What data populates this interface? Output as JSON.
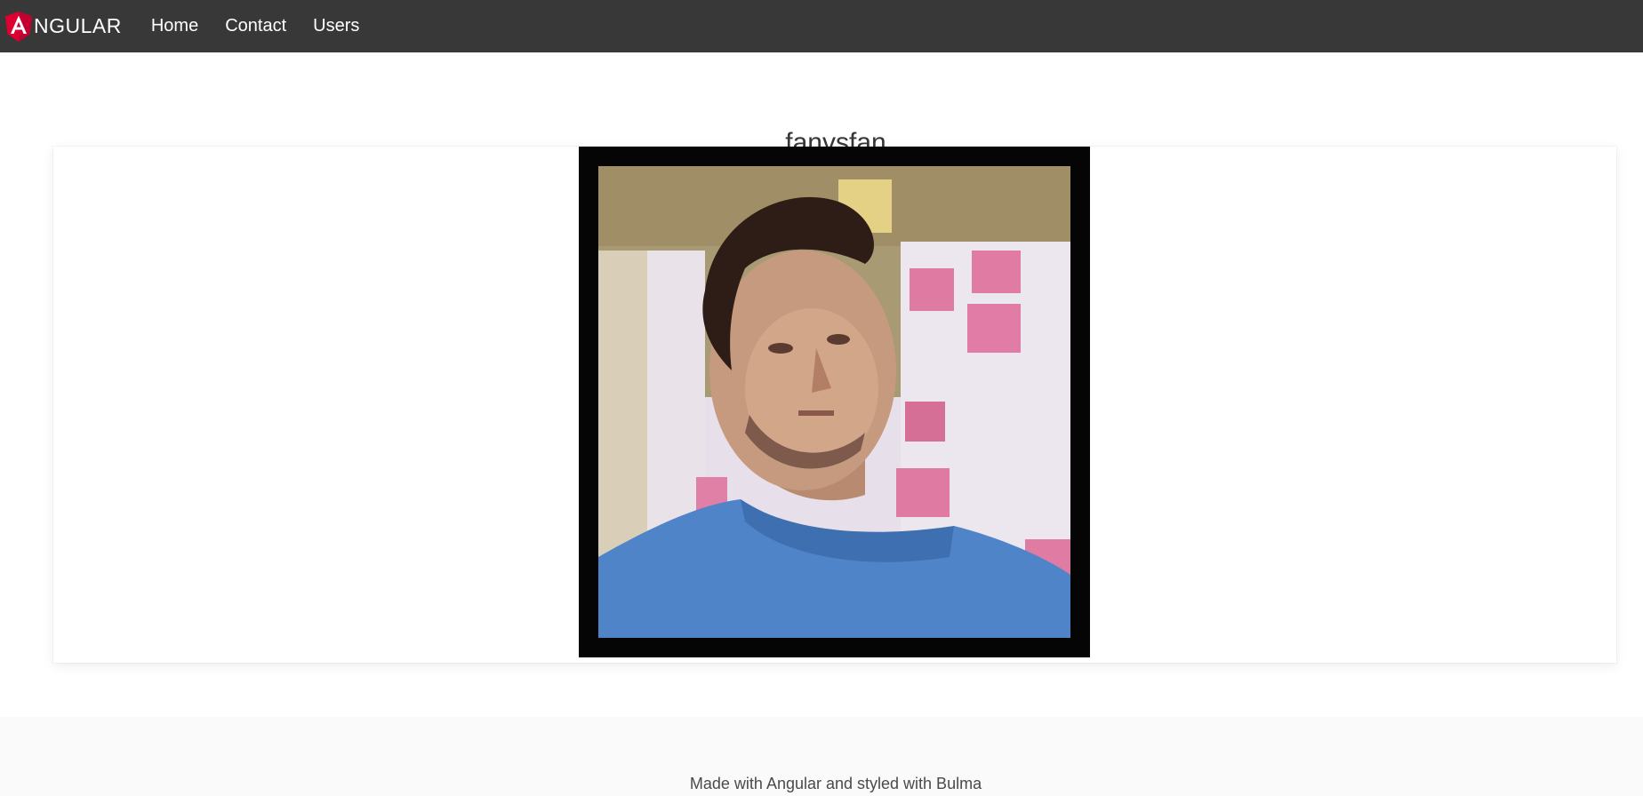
{
  "navbar": {
    "brand_text": "NGULAR",
    "items": [
      {
        "label": "Home"
      },
      {
        "label": "Contact"
      },
      {
        "label": "Users"
      }
    ]
  },
  "profile": {
    "username": "fanvsfan"
  },
  "footer": {
    "text": "Made with Angular and styled with Bulma"
  },
  "colors": {
    "navbar_bg": "#383838",
    "angular_red": "#dd0031",
    "footer_bg": "#fafafa"
  }
}
